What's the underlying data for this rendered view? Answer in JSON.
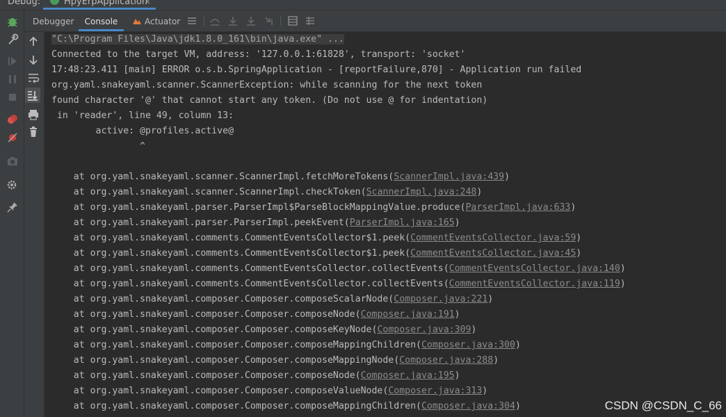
{
  "window": {
    "debug_label": "Debug:",
    "run_config": "HpyErpApplication",
    "close_glyph": "×"
  },
  "tabs": [
    {
      "label": "Debugger",
      "active": false
    },
    {
      "label": "Console",
      "active": true
    },
    {
      "label": "Actuator",
      "active": false
    }
  ],
  "console": {
    "command": "\"C:\\Program Files\\Java\\jdk1.8.0_161\\bin\\java.exe\" ...",
    "lines": [
      "Connected to the target VM, address: '127.0.0.1:61828', transport: 'socket'",
      "17:48:23.411 [main] ERROR o.s.b.SpringApplication - [reportFailure,870] - Application run failed",
      "org.yaml.snakeyaml.scanner.ScannerException: while scanning for the next token",
      "found character '@' that cannot start any token. (Do not use @ for indentation)",
      " in 'reader', line 49, column 13:",
      "        active: @profiles.active@",
      "                ^"
    ],
    "stack": [
      {
        "prefix": "    at org.yaml.snakeyaml.scanner.ScannerImpl.fetchMoreTokens(",
        "link": "ScannerImpl.java:439"
      },
      {
        "prefix": "    at org.yaml.snakeyaml.scanner.ScannerImpl.checkToken(",
        "link": "ScannerImpl.java:248"
      },
      {
        "prefix": "    at org.yaml.snakeyaml.parser.ParserImpl$ParseBlockMappingValue.produce(",
        "link": "ParserImpl.java:633"
      },
      {
        "prefix": "    at org.yaml.snakeyaml.parser.ParserImpl.peekEvent(",
        "link": "ParserImpl.java:165"
      },
      {
        "prefix": "    at org.yaml.snakeyaml.comments.CommentEventsCollector$1.peek(",
        "link": "CommentEventsCollector.java:59"
      },
      {
        "prefix": "    at org.yaml.snakeyaml.comments.CommentEventsCollector$1.peek(",
        "link": "CommentEventsCollector.java:45"
      },
      {
        "prefix": "    at org.yaml.snakeyaml.comments.CommentEventsCollector.collectEvents(",
        "link": "CommentEventsCollector.java:140"
      },
      {
        "prefix": "    at org.yaml.snakeyaml.comments.CommentEventsCollector.collectEvents(",
        "link": "CommentEventsCollector.java:119"
      },
      {
        "prefix": "    at org.yaml.snakeyaml.composer.Composer.composeScalarNode(",
        "link": "Composer.java:221"
      },
      {
        "prefix": "    at org.yaml.snakeyaml.composer.Composer.composeNode(",
        "link": "Composer.java:191"
      },
      {
        "prefix": "    at org.yaml.snakeyaml.composer.Composer.composeKeyNode(",
        "link": "Composer.java:309"
      },
      {
        "prefix": "    at org.yaml.snakeyaml.composer.Composer.composeMappingChildren(",
        "link": "Composer.java:300"
      },
      {
        "prefix": "    at org.yaml.snakeyaml.composer.Composer.composeMappingNode(",
        "link": "Composer.java:288"
      },
      {
        "prefix": "    at org.yaml.snakeyaml.composer.Composer.composeNode(",
        "link": "Composer.java:195"
      },
      {
        "prefix": "    at org.yaml.snakeyaml.composer.Composer.composeValueNode(",
        "link": "Composer.java:313"
      },
      {
        "prefix": "    at org.yaml.snakeyaml.composer.Composer.composeMappingChildren(",
        "link": "Composer.java:304"
      }
    ]
  },
  "watermark": "CSDN @CSDN_C_66",
  "colors": {
    "accent": "#4a88c7",
    "background": "#2b2b2b",
    "text": "#bbbbbb",
    "link": "#8c8c8c"
  }
}
